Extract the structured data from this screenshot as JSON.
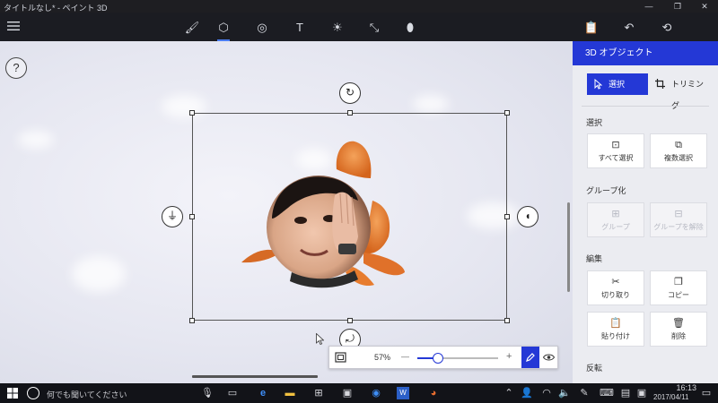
{
  "window": {
    "title": "タイトルなし* - ペイント 3D",
    "minimize_glyph": "—",
    "restore_glyph": "❐",
    "close_glyph": "✕"
  },
  "toolbar": {
    "menu_icon": "hamburger-icon",
    "tools": [
      {
        "name": "brush-tool-icon",
        "glyph": "🖌"
      },
      {
        "name": "3d-object-tool-icon",
        "glyph": "⬡"
      },
      {
        "name": "sticker-tool-icon",
        "glyph": "◎"
      },
      {
        "name": "text-tool-icon",
        "glyph": "T"
      },
      {
        "name": "effects-tool-icon",
        "glyph": "☀"
      },
      {
        "name": "canvas-tool-icon",
        "glyph": "⤡"
      },
      {
        "name": "remix3d-tool-icon",
        "glyph": "⬮"
      }
    ],
    "right_icons": [
      {
        "name": "paste-icon",
        "glyph": "📋"
      },
      {
        "name": "undo-icon",
        "glyph": "↶"
      },
      {
        "name": "history-icon",
        "glyph": "⟲"
      }
    ]
  },
  "canvas": {
    "help_label": "?",
    "rotate_top_glyph": "↻",
    "rotate_left_glyph": "⏚",
    "rotate_right_glyph": "◖",
    "rotate_bottom_glyph": "⤾"
  },
  "zoom": {
    "value": "57%",
    "level": 0.25,
    "minus": "—",
    "plus": "+",
    "fit_icon": "fit-view-icon",
    "pen_icon": "pen-icon",
    "eye_icon": "eye-icon"
  },
  "panel": {
    "title": "3D オブジェクト",
    "mode_select": "選択",
    "mode_trim": "トリミング",
    "sections": {
      "select": "選択",
      "group": "グループ化",
      "edit": "編集",
      "flip": "反転"
    },
    "tiles": {
      "select_all": "すべて選択",
      "multi_select": "複数選択",
      "group": "グループ",
      "ungroup": "グループを解除",
      "cut": "切り取り",
      "copy": "コピー",
      "paste": "貼り付け",
      "delete": "削除"
    },
    "accent_color": "#2438d6"
  },
  "taskbar": {
    "search_placeholder": "何でも聞いてください",
    "time": "16:13",
    "date": "2017/04/11"
  }
}
